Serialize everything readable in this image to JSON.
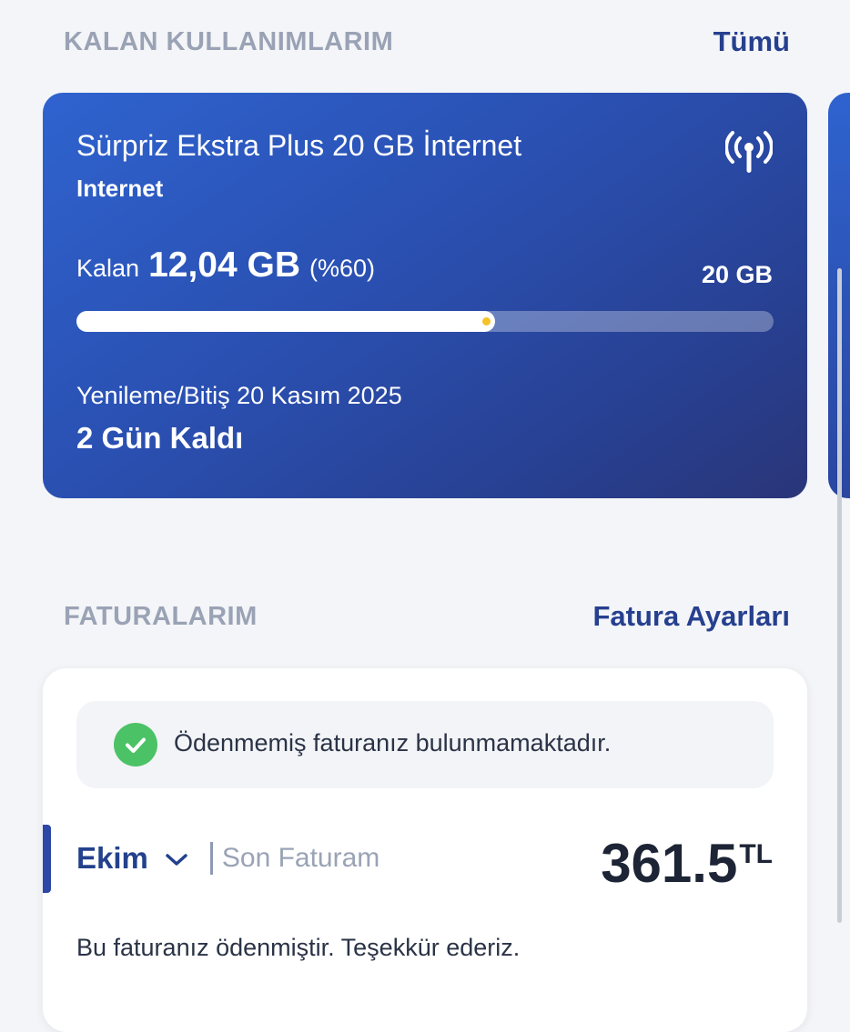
{
  "usage_section": {
    "title": "KALAN KULLANIMLARIM",
    "all_link": "Tümü",
    "card": {
      "package_name": "Sürpriz Ekstra Plus 20 GB İnternet",
      "package_type": "Internet",
      "icon": "signal-tower-icon",
      "remaining_label": "Kalan",
      "remaining_value": "12,04 GB",
      "remaining_percent_text": "(%60)",
      "remaining_fraction": 0.6,
      "total": "20 GB",
      "renewal_label": "Yenileme/Bitiş 20 Kasım 2025",
      "days_left": "2 Gün Kaldı"
    }
  },
  "invoice_section": {
    "title": "FATURALARIM",
    "settings_link": "Fatura Ayarları",
    "notice_text": "Ödenmemiş faturanız bulunmamaktadır.",
    "month": "Ekim",
    "last_invoice_label": "Son Faturam",
    "amount": "361.5",
    "currency": "TL",
    "paid_message": "Bu faturanız ödenmiştir. Teşekkür ederiz."
  },
  "colors": {
    "accent": "#26408f",
    "card_gradient_start": "#2f63cf",
    "card_gradient_end": "#2a3578",
    "success": "#4cc267",
    "progress_marker": "#f5c329"
  }
}
